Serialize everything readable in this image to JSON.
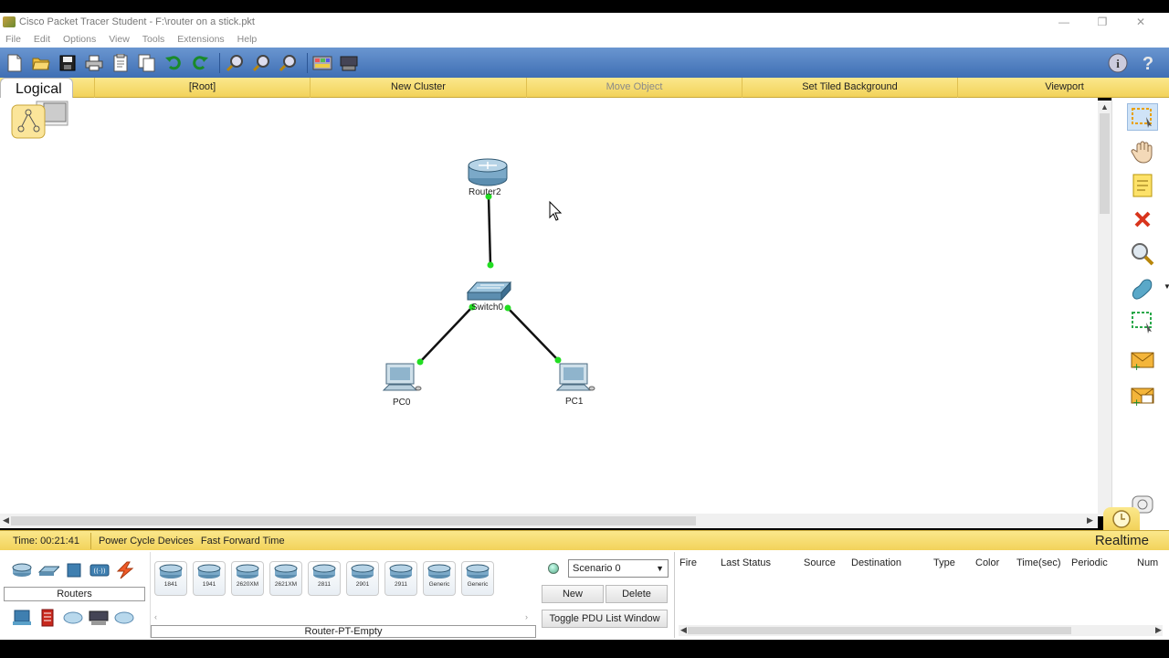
{
  "window": {
    "title": "Cisco Packet Tracer Student - F:\\router on a stick.pkt",
    "controls": [
      "—",
      "❐",
      "✕"
    ]
  },
  "menu": [
    "File",
    "Edit",
    "Options",
    "View",
    "Tools",
    "Extensions",
    "Help"
  ],
  "workspace": {
    "logical_tab": "Logical",
    "items": [
      {
        "label": "[Root]",
        "disabled": false
      },
      {
        "label": "New Cluster",
        "disabled": false
      },
      {
        "label": "Move Object",
        "disabled": true
      },
      {
        "label": "Set Tiled Background",
        "disabled": false
      },
      {
        "label": "Viewport",
        "disabled": false
      }
    ]
  },
  "topology": {
    "nodes": [
      {
        "id": "Router2",
        "label": "Router2",
        "kind": "router"
      },
      {
        "id": "Switch0",
        "label": "Switch0",
        "kind": "switch"
      },
      {
        "id": "PC0",
        "label": "PC0",
        "kind": "pc"
      },
      {
        "id": "PC1",
        "label": "PC1",
        "kind": "pc"
      }
    ],
    "links": [
      {
        "from": "Router2",
        "to": "Switch0",
        "status": "up",
        "color": "#22dd22"
      },
      {
        "from": "Switch0",
        "to": "PC0",
        "status": "up",
        "color": "#22dd22"
      },
      {
        "from": "Switch0",
        "to": "PC1",
        "status": "up",
        "color": "#22dd22"
      }
    ]
  },
  "status": {
    "time": "Time: 00:21:41",
    "power_cycle": "Power Cycle Devices",
    "fast_forward": "Fast Forward Time",
    "mode": "Realtime"
  },
  "device_panel": {
    "category_label": "Routers",
    "models": [
      "1841",
      "1941",
      "2620XM",
      "2621XM",
      "2811",
      "2901",
      "2911",
      "Generic",
      "Generic"
    ],
    "selected_name": "Router-PT-Empty"
  },
  "scenario": {
    "selected": "Scenario 0",
    "new_label": "New",
    "delete_label": "Delete",
    "toggle_label": "Toggle PDU List Window"
  },
  "pdu_columns": [
    "Fire",
    "Last Status",
    "Source",
    "Destination",
    "Type",
    "Color",
    "Time(sec)",
    "Periodic",
    "Num"
  ],
  "icons": {
    "toolbar": [
      "new-file-icon",
      "open-folder-icon",
      "save-icon",
      "print-icon",
      "activity-wizard-icon",
      "copy-icon",
      "undo-icon",
      "redo-icon",
      "zoom-in-icon",
      "zoom-reset-icon",
      "zoom-out-icon",
      "palette-icon",
      "custom-device-icon"
    ],
    "right_panel": [
      "select-icon",
      "move-layout-icon",
      "place-note-icon",
      "delete-icon",
      "inspect-icon",
      "draw-shape-icon",
      "resize-shape-icon",
      "add-simple-pdu-icon",
      "add-complex-pdu-icon"
    ]
  }
}
